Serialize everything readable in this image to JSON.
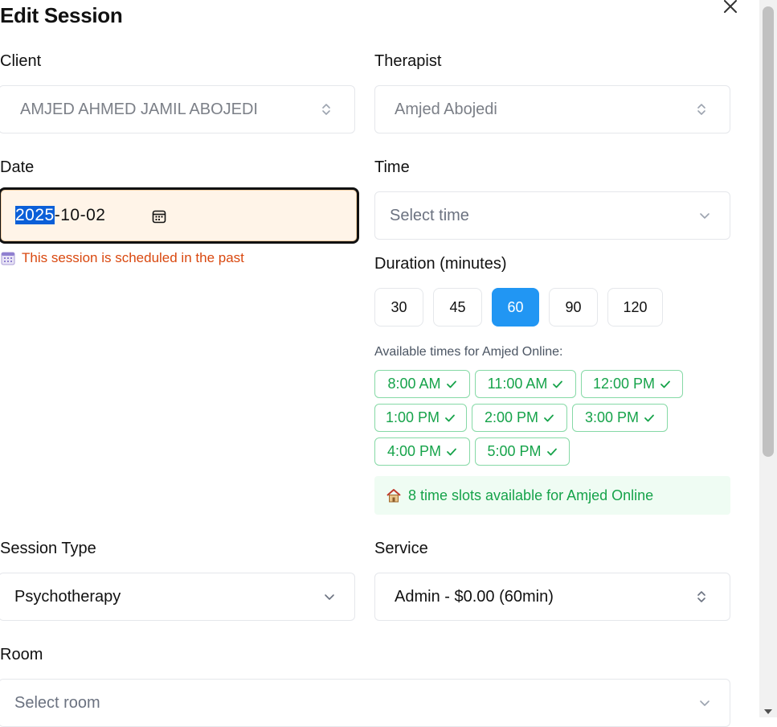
{
  "dialog": {
    "title": "Edit Session"
  },
  "client": {
    "label": "Client",
    "value": "AMJED AHMED JAMIL ABOJEDI"
  },
  "therapist": {
    "label": "Therapist",
    "value": "Amjed Abojedi"
  },
  "date": {
    "label": "Date",
    "year": "2025",
    "rest": "-10-02",
    "warning": "This session is scheduled in the past"
  },
  "time": {
    "label": "Time",
    "placeholder": "Select time"
  },
  "duration": {
    "label": "Duration (minutes)",
    "options": [
      "30",
      "45",
      "60",
      "90",
      "120"
    ],
    "selected": "60"
  },
  "availability": {
    "label": "Available times for Amjed Online:",
    "slots": [
      "8:00 AM",
      "11:00 AM",
      "12:00 PM",
      "1:00 PM",
      "2:00 PM",
      "3:00 PM",
      "4:00 PM",
      "5:00 PM"
    ],
    "summary": "8 time slots available for Amjed Online"
  },
  "session_type": {
    "label": "Session Type",
    "value": "Psychotherapy"
  },
  "service": {
    "label": "Service",
    "value": "Admin - $0.00 (60min)"
  },
  "room": {
    "label": "Room",
    "placeholder": "Select room"
  },
  "colors": {
    "accent": "#2196f3",
    "success": "#16a34a",
    "warning": "#d9480f",
    "date_bg": "#fff4e8"
  }
}
